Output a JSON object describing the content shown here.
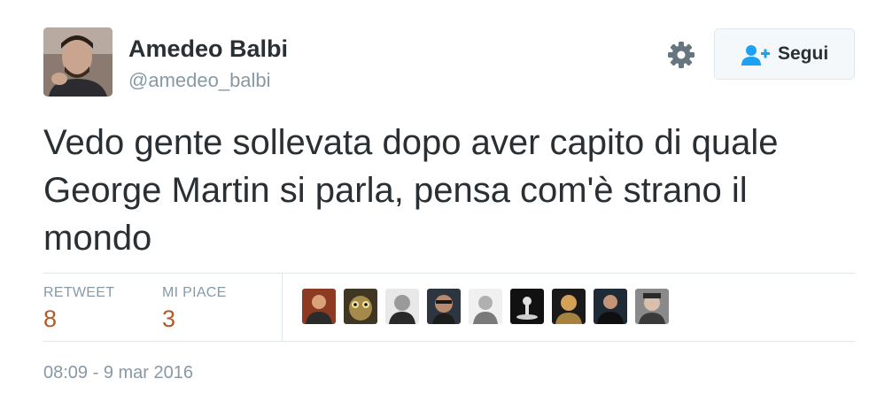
{
  "user": {
    "name": "Amedeo Balbi",
    "handle": "@amedeo_balbi",
    "avatar_icon": "user-avatar-photo"
  },
  "actions": {
    "settings_icon": "gear-icon",
    "follow_icon": "add-user-icon",
    "follow_label": "Segui"
  },
  "tweet": {
    "text": "Vedo gente sollevata dopo aver capito di quale George Martin si parla, pensa com'è strano il mondo"
  },
  "stats": {
    "retweet_label": "RETWEET",
    "retweet_count": "8",
    "likes_label": "MI PIACE",
    "likes_count": "3"
  },
  "likers": [
    {
      "icon": "liker-avatar-1",
      "bg": "#c24a2a"
    },
    {
      "icon": "liker-avatar-2",
      "bg": "#6b5a2e"
    },
    {
      "icon": "liker-avatar-3",
      "bg": "#3b3b3b"
    },
    {
      "icon": "liker-avatar-4",
      "bg": "#2d3540"
    },
    {
      "icon": "liker-avatar-5",
      "bg": "#d8d8d8"
    },
    {
      "icon": "liker-avatar-6",
      "bg": "#111111"
    },
    {
      "icon": "liker-avatar-7",
      "bg": "#5a4a2a"
    },
    {
      "icon": "liker-avatar-8",
      "bg": "#1e2a36"
    },
    {
      "icon": "liker-avatar-9",
      "bg": "#6f6f6f"
    }
  ],
  "timestamp": "08:09 - 9 mar 2016",
  "colors": {
    "text": "#292f33",
    "muted": "#8899a6",
    "stat_value": "#b05b2c",
    "follow_icon": "#1da1f2",
    "divider": "#e1e8ed"
  }
}
